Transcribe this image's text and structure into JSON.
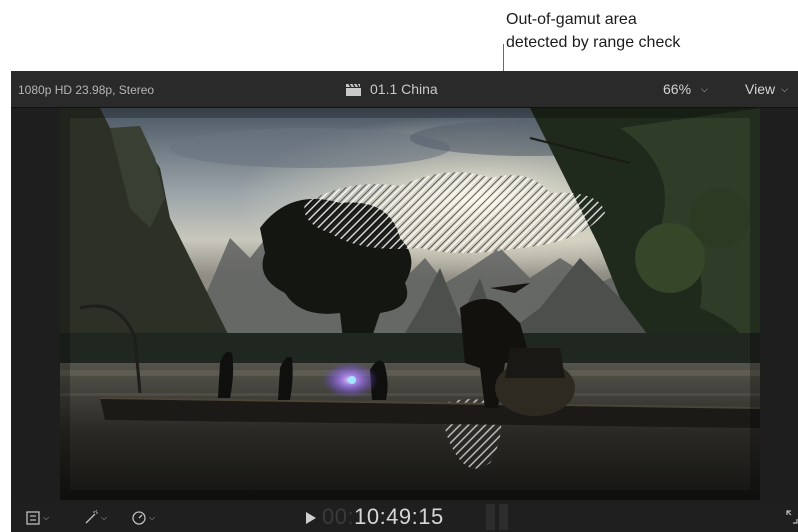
{
  "callout": {
    "line1": "Out-of-gamut area",
    "line2": "detected by range check"
  },
  "viewer": {
    "format_label": "1080p HD 23.98p, Stereo",
    "clip_title": "01.1 China",
    "zoom_level": "66%",
    "view_menu_label": "View",
    "timecode_dim": "00:",
    "timecode_main": "10:49:15"
  },
  "icons": {
    "clapper": "clapperboard-icon",
    "transform": "transform-icon",
    "enhance": "magic-wand-icon",
    "retime": "speedometer-icon",
    "play": "play-icon",
    "fullscreen": "fullscreen-icon"
  }
}
